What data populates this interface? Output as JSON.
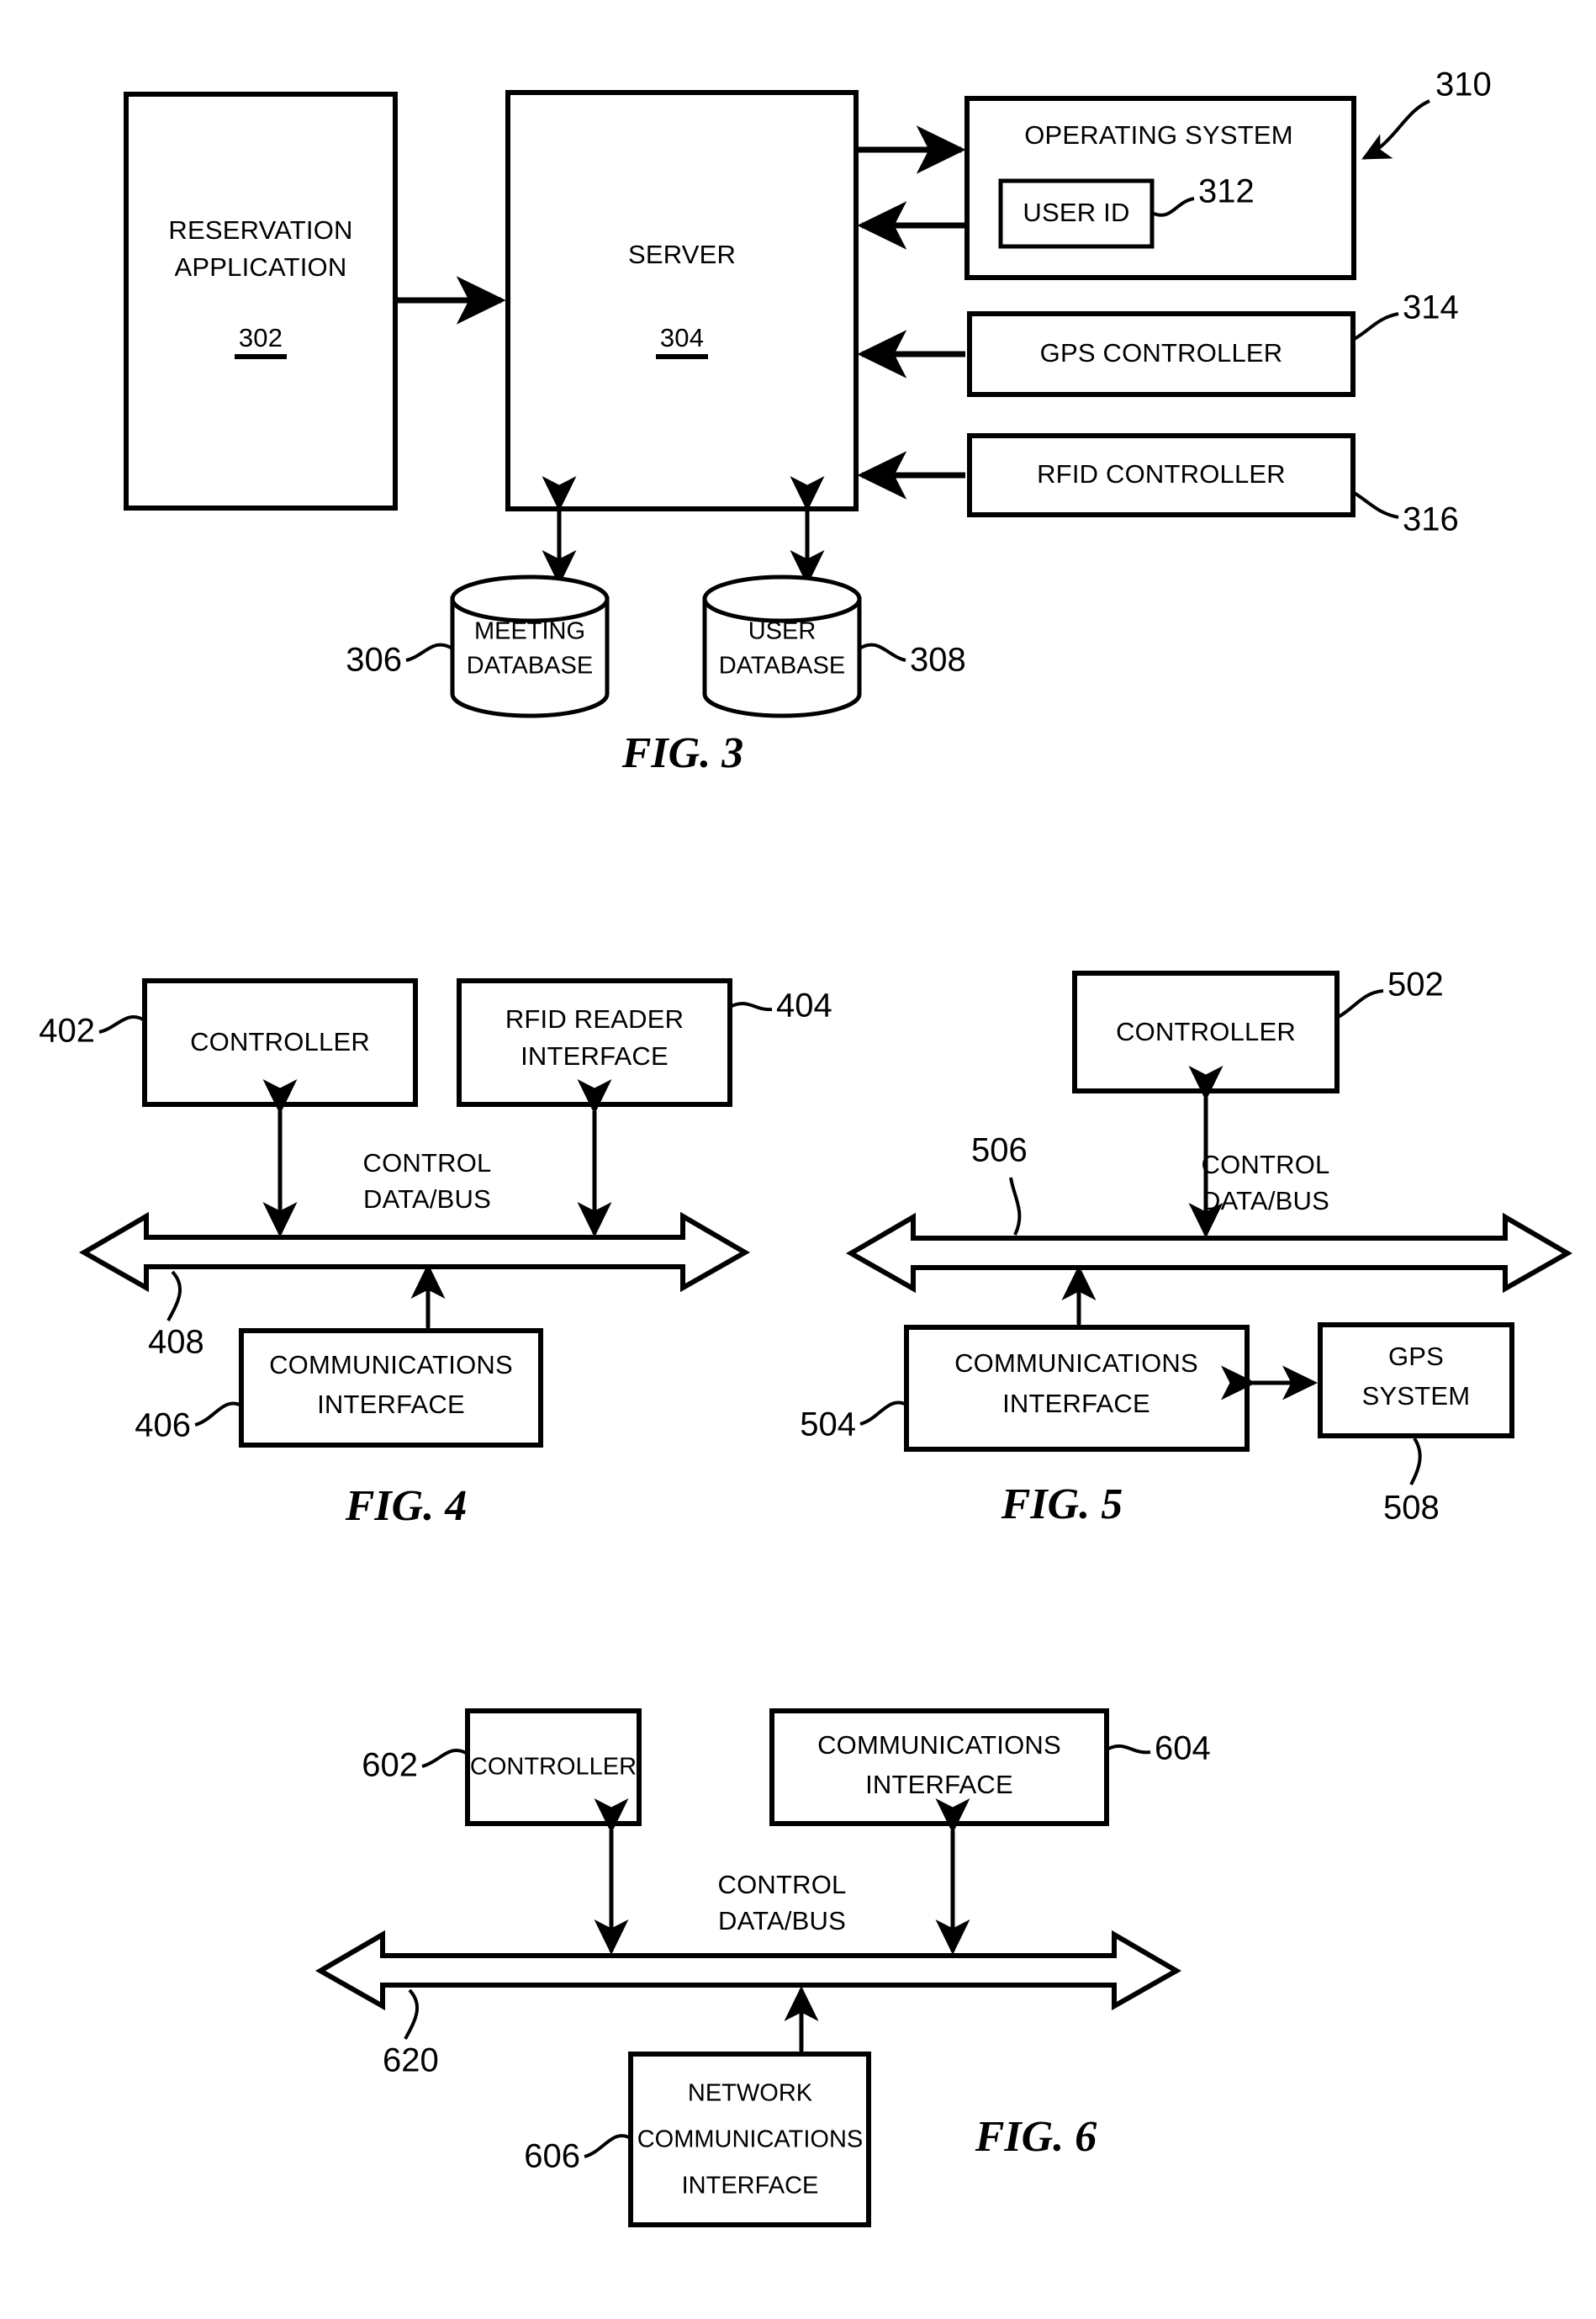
{
  "document": {
    "type": "patent-drawing-sheet",
    "figures": [
      "FIG. 3",
      "FIG. 4",
      "FIG. 5",
      "FIG. 6"
    ]
  },
  "fig3": {
    "caption": "FIG. 3",
    "blocks": {
      "reservation_application": {
        "line1": "RESERVATION",
        "line2": "APPLICATION",
        "ref": "302"
      },
      "server": {
        "line1": "SERVER",
        "ref": "304"
      },
      "operating_system": {
        "label": "OPERATING SYSTEM",
        "ref": "310"
      },
      "user_id": {
        "label": "USER ID",
        "ref": "312"
      },
      "gps_controller": {
        "label": "GPS CONTROLLER",
        "ref": "314"
      },
      "rfid_controller": {
        "label": "RFID CONTROLLER",
        "ref": "316"
      },
      "meeting_database": {
        "line1": "MEETING",
        "line2": "DATABASE",
        "ref": "306"
      },
      "user_database": {
        "line1": "USER",
        "line2": "DATABASE",
        "ref": "308"
      }
    }
  },
  "fig4": {
    "caption": "FIG. 4",
    "blocks": {
      "controller": {
        "label": "CONTROLLER",
        "ref": "402"
      },
      "rfid_reader_interface": {
        "line1": "RFID READER",
        "line2": "INTERFACE",
        "ref": "404"
      },
      "communications_interface": {
        "line1": "COMMUNICATIONS",
        "line2": "INTERFACE",
        "ref": "406"
      },
      "bus": {
        "line1": "CONTROL",
        "line2": "DATA/BUS",
        "ref": "408"
      }
    }
  },
  "fig5": {
    "caption": "FIG. 5",
    "blocks": {
      "controller": {
        "label": "CONTROLLER",
        "ref": "502"
      },
      "communications_interface": {
        "line1": "COMMUNICATIONS",
        "line2": "INTERFACE",
        "ref": "504"
      },
      "gps_system": {
        "line1": "GPS",
        "line2": "SYSTEM",
        "ref": "508"
      },
      "bus": {
        "line1": "CONTROL",
        "line2": "DATA/BUS",
        "ref": "506"
      }
    }
  },
  "fig6": {
    "caption": "FIG. 6",
    "blocks": {
      "controller": {
        "label": "CONTROLLER",
        "ref": "602"
      },
      "communications_interface": {
        "line1": "COMMUNICATIONS",
        "line2": "INTERFACE",
        "ref": "604"
      },
      "network_communications_interface": {
        "line1": "NETWORK",
        "line2": "COMMUNICATIONS",
        "line3": "INTERFACE",
        "ref": "606"
      },
      "bus": {
        "line1": "CONTROL",
        "line2": "DATA/BUS",
        "ref": "620"
      }
    }
  },
  "colors": {
    "ink": "#000000",
    "paper": "#ffffff"
  }
}
